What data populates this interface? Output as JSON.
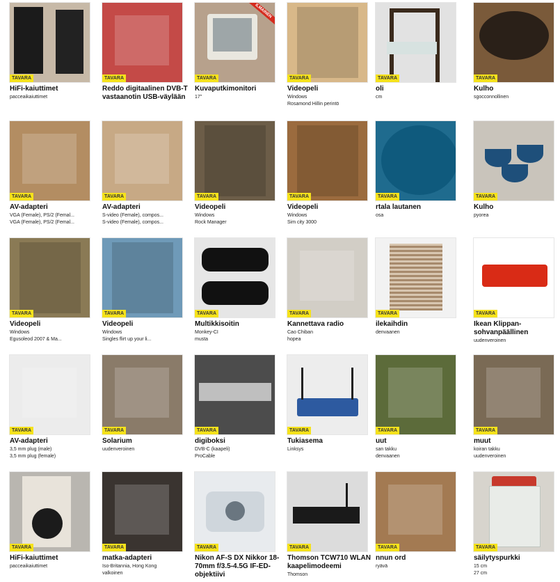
{
  "badge_label": "TAVARA",
  "items": [
    {
      "title": "HiFi-kaiuttimet",
      "sub": [
        "pacceaikaiuttimet"
      ],
      "icon": "speakers-photo",
      "bg": "#c7b9a7",
      "ribbon": ""
    },
    {
      "title": "Reddo digitaalinen DVB-T vastaanotin USB-väylään",
      "sub": [],
      "icon": "tv-tuner-photo",
      "bg": "#c44a47",
      "ribbon": ""
    },
    {
      "title": "Kuvaputkimonitori",
      "sub": [
        "17\""
      ],
      "icon": "crt-monitor-photo",
      "bg": "#b7a18c",
      "ribbon": "ILMAINEN"
    },
    {
      "title": "Videopeli",
      "sub": [
        "Windows",
        "Rosamond Hillin perintö"
      ],
      "icon": "game-box-photo",
      "bg": "#d8b889",
      "ribbon": ""
    },
    {
      "title": "oli",
      "sub": [
        "cm"
      ],
      "icon": "chair-photo",
      "bg": "#e2e2e2",
      "ribbon": ""
    },
    {
      "title": "Kulho",
      "sub": [
        "sgocconnollinen"
      ],
      "icon": "bowl-photo",
      "bg": "#7a5a3a",
      "ribbon": ""
    },
    {
      "title": "AV-adapteri",
      "sub": [
        "VGA (Female), PS/2 (Femal...",
        "VGA (Female), PS/2 (Femal..."
      ],
      "icon": "av-switch-photo",
      "bg": "#b38d62",
      "ribbon": ""
    },
    {
      "title": "AV-adapteri",
      "sub": [
        "S-video (Female), compos...",
        "S-video (Female), compos..."
      ],
      "icon": "adapter-device-photo",
      "bg": "#c7a985",
      "ribbon": ""
    },
    {
      "title": "Videopeli",
      "sub": [
        "Windows",
        "Rock Manager"
      ],
      "icon": "game-box-photo",
      "bg": "#6c5d48",
      "ribbon": ""
    },
    {
      "title": "Videopeli",
      "sub": [
        "Windows",
        "Sim city 3000"
      ],
      "icon": "game-box-photo",
      "bg": "#9b6b3e",
      "ribbon": ""
    },
    {
      "title": "rtala lautanen",
      "sub": [
        "osa"
      ],
      "icon": "plate-photo",
      "bg": "#1f6b8e",
      "ribbon": ""
    },
    {
      "title": "Kulho",
      "sub": [
        "pyorea"
      ],
      "icon": "bowls-photo",
      "bg": "#c9c4bb",
      "ribbon": ""
    },
    {
      "title": "Videopeli",
      "sub": [
        "Windows",
        "Egusoleod 2007 & Ma..."
      ],
      "icon": "game-box-photo",
      "bg": "#8a7a55",
      "ribbon": ""
    },
    {
      "title": "Videopeli",
      "sub": [
        "Windows",
        "Singles flirt up your li..."
      ],
      "icon": "game-box-photo",
      "bg": "#6f9ab8",
      "ribbon": ""
    },
    {
      "title": "Multikkisoitin",
      "sub": [
        "Monkey-CI",
        "musta"
      ],
      "icon": "media-player-photo",
      "bg": "#e6e6e6",
      "ribbon": ""
    },
    {
      "title": "Kannettava radio",
      "sub": [
        "Cao Chiban",
        "hopea"
      ],
      "icon": "earphones-photo",
      "bg": "#d2cec6",
      "ribbon": ""
    },
    {
      "title": "ilekaihdin",
      "sub": [
        "denvaanen"
      ],
      "icon": "blind-photo",
      "bg": "#f2f2f2",
      "ribbon": ""
    },
    {
      "title": "Ikean Klippan-sohvanpäällinen",
      "sub": [
        "uudenveroinen"
      ],
      "icon": "sofa-photo",
      "bg": "#ffffff",
      "ribbon": ""
    },
    {
      "title": "AV-adapteri",
      "sub": [
        "3,5 mm plug (male)",
        "3,5 mm plug (female)"
      ],
      "icon": "cassette-adapter-photo",
      "bg": "#ececec",
      "ribbon": ""
    },
    {
      "title": "Solarium",
      "sub": [
        "uudenveroinen"
      ],
      "icon": "solarium-photo",
      "bg": "#8a7b69",
      "ribbon": ""
    },
    {
      "title": "digiboksi",
      "sub": [
        "DVB-C (kaapeli)",
        "ProCable"
      ],
      "icon": "set-top-box-photo",
      "bg": "#4c4c4c",
      "ribbon": ""
    },
    {
      "title": "Tukiasema",
      "sub": [
        "Linksys"
      ],
      "icon": "router-photo",
      "bg": "#ededed",
      "ribbon": ""
    },
    {
      "title": "uut",
      "sub": [
        "san takku",
        "denvaanen"
      ],
      "icon": "fabric-photo",
      "bg": "#5c6b3a",
      "ribbon": ""
    },
    {
      "title": "muut",
      "sub": [
        "koiran takku",
        "uudenveroinen"
      ],
      "icon": "dog-coat-photo",
      "bg": "#7a6a55",
      "ribbon": ""
    },
    {
      "title": "HiFi-kaiuttimet",
      "sub": [
        "pacceaikaiuttimet"
      ],
      "icon": "speaker-closeup-photo",
      "bg": "#b9b6b0",
      "ribbon": ""
    },
    {
      "title": "matka-adapteri",
      "sub": [
        "Iso-Britannia, Hong Kong",
        "valkoinen"
      ],
      "icon": "travel-adapter-photo",
      "bg": "#3a3430",
      "ribbon": ""
    },
    {
      "title": "Nikon AF-S DX Nikkor 18-70mm f/3.5-4.5G IF-ED-objektiivi",
      "sub": [],
      "icon": "camera-photo",
      "bg": "#e8ebee",
      "ribbon": ""
    },
    {
      "title": "Thomson TCW710 WLAN kaapelimodeemi",
      "sub": [
        "Thomson"
      ],
      "icon": "modem-photo",
      "bg": "#dcdcdc",
      "ribbon": ""
    },
    {
      "title": "nnun ord",
      "sub": [
        "ryävä"
      ],
      "icon": "swing-photo",
      "bg": "#a37a52",
      "ribbon": ""
    },
    {
      "title": "säilytyspurkki",
      "sub": [
        "15 cm",
        "27 cm"
      ],
      "icon": "jar-photo",
      "bg": "#d7d4cd",
      "ribbon": ""
    }
  ]
}
